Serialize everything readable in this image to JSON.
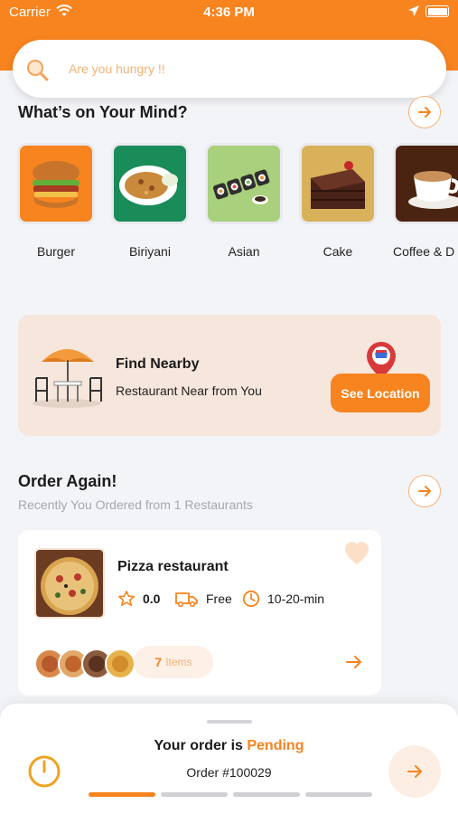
{
  "status_bar": {
    "carrier": "Carrier",
    "time": "4:36 PM"
  },
  "search": {
    "placeholder": "Are you hungry !!"
  },
  "categories_section": {
    "title": "What’s on Your Mind?",
    "items": [
      {
        "label": "Burger",
        "icon": "burger-image"
      },
      {
        "label": "Biriyani",
        "icon": "biriyani-image"
      },
      {
        "label": "Asian",
        "icon": "sushi-image"
      },
      {
        "label": "Cake",
        "icon": "cake-image"
      },
      {
        "label": "Coffee & D",
        "icon": "coffee-image"
      }
    ]
  },
  "nearby": {
    "title": "Find Nearby",
    "subtitle": "Restaurant Near from You",
    "button_label": "See Location"
  },
  "order_again": {
    "title": "Order Again!",
    "subtitle": "Recently You Ordered from 1 Restaurants",
    "card": {
      "restaurant_name": "Pizza restaurant",
      "rating": "0.0",
      "delivery": "Free",
      "time": "10-20-min",
      "items_count": "7",
      "items_word": "Items"
    }
  },
  "order_status": {
    "prefix": "Your order is",
    "state": "Pending",
    "order_number": "Order #100029",
    "progress_steps": 4,
    "progress_completed": 1
  },
  "colors": {
    "accent": "#f7841f",
    "accent_light": "#fdeee3",
    "background": "#f3f4f7"
  }
}
